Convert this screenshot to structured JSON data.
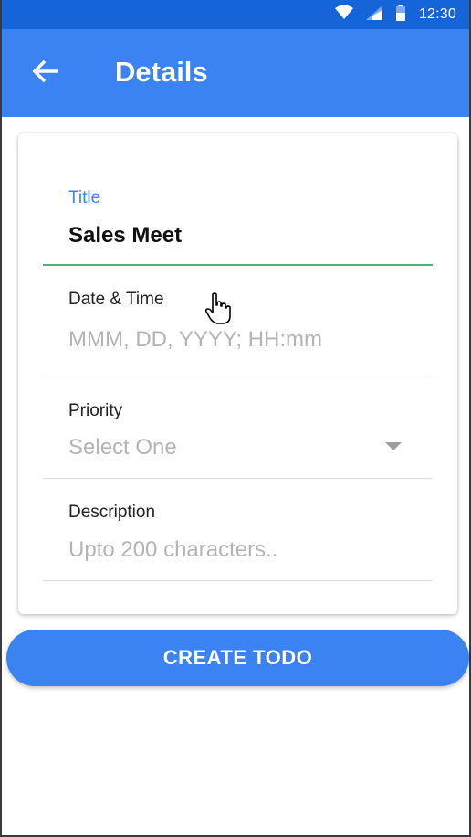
{
  "status_bar": {
    "time": "12:30",
    "icons": [
      "wifi-icon",
      "signal-icon",
      "battery-icon"
    ]
  },
  "app_bar": {
    "title": "Details",
    "back_icon": "arrow-left-icon"
  },
  "form": {
    "title": {
      "label": "Title",
      "value": "Sales Meet"
    },
    "date_time": {
      "label": "Date & Time",
      "placeholder": "MMM, DD, YYYY; HH:mm"
    },
    "priority": {
      "label": "Priority",
      "selected": "Select One"
    },
    "description": {
      "label": "Description",
      "placeholder": "Upto 200 characters.."
    }
  },
  "create_button": {
    "label": "CREATE TODO"
  },
  "colors": {
    "primary": "#3b82f3",
    "status_bar": "#1565d8",
    "active_underline": "#3cb878",
    "active_label": "#3b82f3",
    "placeholder": "#b4b4b4"
  }
}
